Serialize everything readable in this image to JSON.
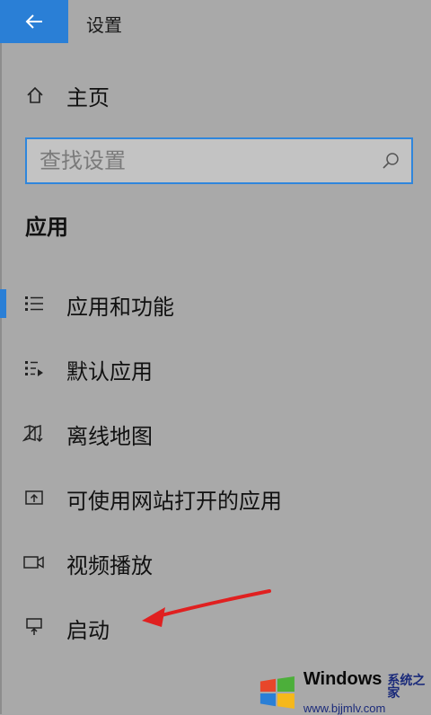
{
  "header": {
    "back_icon": "arrow-left-icon",
    "title": "设置"
  },
  "home": {
    "icon": "home-icon",
    "label": "主页"
  },
  "search": {
    "placeholder": "查找设置",
    "icon": "search-icon"
  },
  "section": {
    "title": "应用"
  },
  "nav": {
    "items": [
      {
        "label": "应用和功能",
        "icon": "list-icon",
        "active": true
      },
      {
        "label": "默认应用",
        "icon": "default-apps-icon",
        "active": false
      },
      {
        "label": "离线地图",
        "icon": "offline-map-icon",
        "active": false
      },
      {
        "label": "可使用网站打开的应用",
        "icon": "web-apps-icon",
        "active": false
      },
      {
        "label": "视频播放",
        "icon": "video-icon",
        "active": false
      },
      {
        "label": "启动",
        "icon": "startup-icon",
        "active": false
      }
    ]
  },
  "annotation": {
    "arrow_color": "#e02020"
  },
  "colors": {
    "accent": "#2a7fd6",
    "background": "#a9a9a9"
  },
  "watermark": {
    "title": "Windows",
    "subtitle": "系统之家",
    "url": "www.bjjmlv.com"
  }
}
